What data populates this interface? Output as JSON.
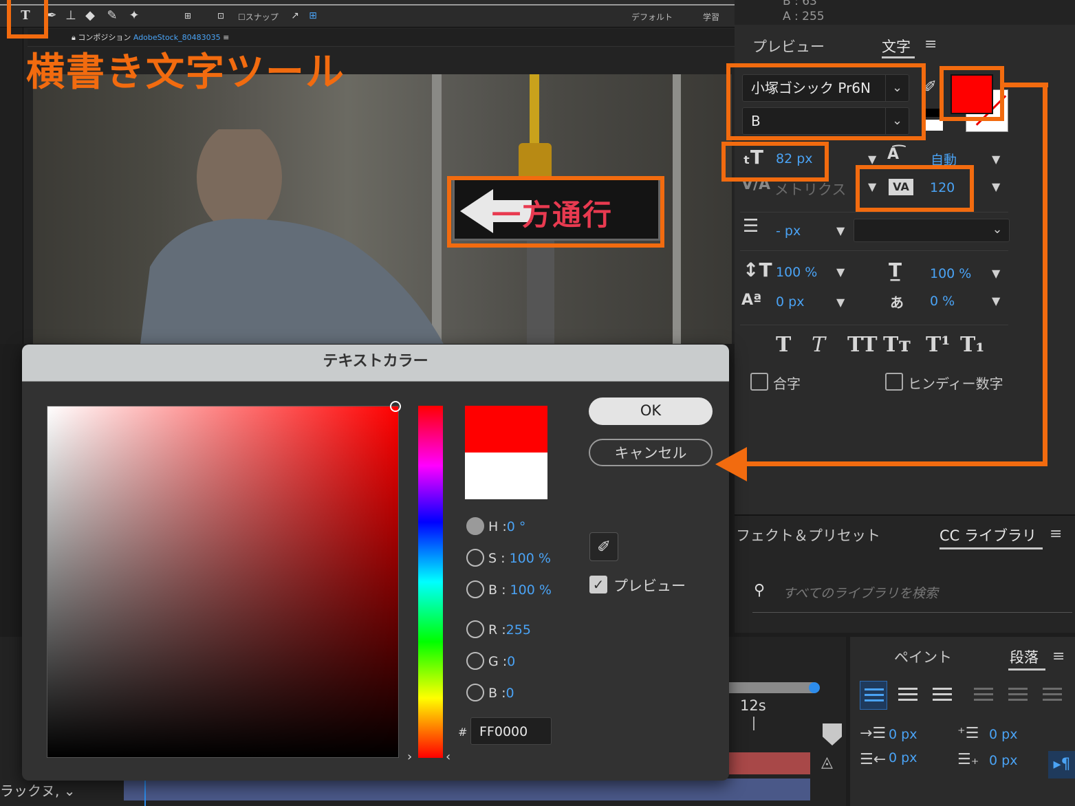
{
  "toolbar": {
    "snap_label": "スナップ",
    "workspace_default": "デフォルト",
    "workspace_learn": "学習"
  },
  "composition": {
    "tab_label": "コンポジション",
    "tab_file": "AdobeStock_80483035",
    "sign_text": "一方通行"
  },
  "annotation": {
    "tool_caption": "横書き文字ツール",
    "color": "#f26b0f"
  },
  "character_panel": {
    "tab_preview": "プレビュー",
    "tab_character": "文字",
    "font_family": "小塚ゴシック Pr6N",
    "font_style": "B",
    "fill_color": "#ff0000",
    "font_size": "82 px",
    "leading": "自動",
    "kerning": "メトリクス",
    "tracking": "120",
    "stroke_width": "- px",
    "vertical_scale": "100 %",
    "horizontal_scale": "100 %",
    "baseline_shift": "0 px",
    "tsume": "0 %",
    "ligatures_label": "合字",
    "hindi_digits_label": "ヒンディー数字",
    "top_partial": "B : 63",
    "top_partial2": "A : 255"
  },
  "library_panel": {
    "tab_effects": "フェクト＆プリセット",
    "tab_cc": "CC ライブラリ",
    "search_placeholder": "すべてのライブラリを検索"
  },
  "paragraph_panel": {
    "tab_paint": "ペイント",
    "tab_paragraph": "段落",
    "indent_left": "0 px",
    "indent_right": "0 px",
    "space_before": "0 px",
    "space_after": "0 px"
  },
  "timeline": {
    "time_marker": "12s",
    "layer_label": "ラックヌ,"
  },
  "dialog": {
    "title": "テキストカラー",
    "ok_label": "OK",
    "cancel_label": "キャンセル",
    "preview_label": "プレビュー",
    "h_label": "H :",
    "h_value": "0 °",
    "s_label": "S :",
    "s_value": "100 %",
    "b_label": "B :",
    "b_value": "100 %",
    "r_label": "R :",
    "r_value": "255",
    "g_label": "G :",
    "g_value": "0",
    "b2_label": "B :",
    "b2_value": "0",
    "hex_prefix": "#",
    "hex_value": "FF0000",
    "new_color": "#ff0000",
    "old_color": "#ffffff"
  }
}
